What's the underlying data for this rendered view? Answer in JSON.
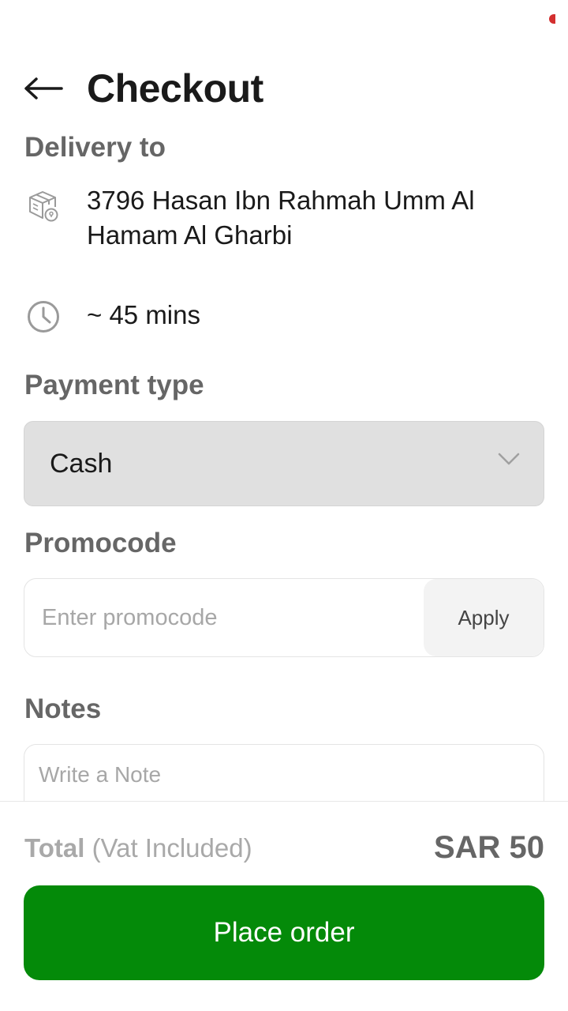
{
  "header": {
    "title": "Checkout",
    "back_icon": "arrow-left-icon"
  },
  "delivery": {
    "label": "Delivery to",
    "address_line1": "3796 Hasan Ibn Rahmah Umm Al",
    "address_line2": "Hamam Al Gharbi",
    "address_icon": "delivery-box-icon",
    "eta": "~ 45 mins",
    "eta_icon": "clock-icon"
  },
  "payment": {
    "label": "Payment type",
    "selected": "Cash"
  },
  "promo": {
    "label": "Promocode",
    "placeholder": "Enter promocode",
    "apply_label": "Apply",
    "value": ""
  },
  "notes": {
    "label": "Notes",
    "placeholder": "Write a Note"
  },
  "footer": {
    "total_label": "Total",
    "total_suffix": "(Vat Included)",
    "total_value": "SAR 50",
    "place_order_label": "Place order"
  },
  "colors": {
    "accent_green": "#048a09",
    "status_red": "#d32f2f",
    "label_gray": "#666666"
  }
}
